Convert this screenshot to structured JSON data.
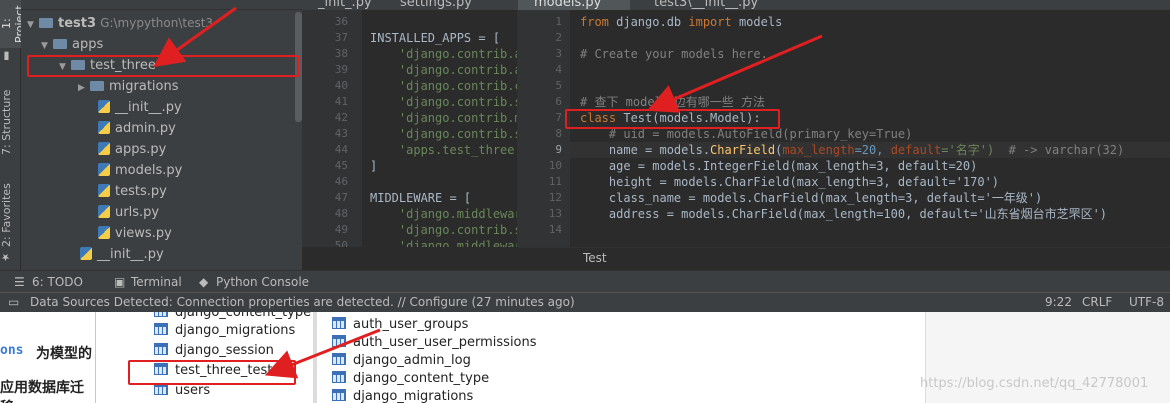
{
  "left_strip": {
    "project_tab": "1: Project",
    "structure_tab": "7: Structure",
    "favorites_tab": "2: Favorites"
  },
  "project_panel": {
    "header": "Project",
    "tree": [
      {
        "label": "test3",
        "suffix": "G:\\mypython\\test3",
        "type": "folder",
        "depth": 0,
        "expanded": true
      },
      {
        "label": "apps",
        "type": "folder",
        "depth": 1,
        "expanded": true
      },
      {
        "label": "test_three",
        "type": "folder",
        "depth": 2,
        "expanded": true
      },
      {
        "label": "migrations",
        "type": "folder",
        "depth": 3,
        "expanded": false
      },
      {
        "label": "__init__.py",
        "type": "py",
        "depth": 3
      },
      {
        "label": "admin.py",
        "type": "py",
        "depth": 3
      },
      {
        "label": "apps.py",
        "type": "py",
        "depth": 3
      },
      {
        "label": "models.py",
        "type": "py",
        "depth": 3
      },
      {
        "label": "tests.py",
        "type": "py",
        "depth": 3
      },
      {
        "label": "urls.py",
        "type": "py",
        "depth": 3
      },
      {
        "label": "views.py",
        "type": "py",
        "depth": 3
      },
      {
        "label": "__init__.py",
        "type": "py",
        "depth": 2
      }
    ]
  },
  "tabs": {
    "t1": "_init_.py",
    "t2": "settings.py",
    "t3": "models.py",
    "t4": "test3\\__init__.py"
  },
  "settings_editor": {
    "line_numbers": [
      "36",
      "37",
      "38",
      "39",
      "40",
      "41",
      "42",
      "43",
      "44",
      "45",
      "46",
      "47",
      "48",
      "49",
      "50"
    ],
    "lines": [
      "",
      "INSTALLED_APPS = [",
      "    'django.contrib.a",
      "    'django.contrib.a",
      "    'django.contrib.c",
      "    'django.contrib.s",
      "    'django.contrib.m",
      "    'django.contrib.s",
      "    'apps.test_three'",
      "]",
      "",
      "MIDDLEWARE = [",
      "    'django.middlewar",
      "    'django.contrib.s",
      "    'django.middlewar"
    ]
  },
  "models_editor": {
    "line_numbers": [
      "1",
      "2",
      "3",
      "4",
      "5",
      "6",
      "7",
      "8",
      "9",
      "10",
      "11",
      "12",
      "13",
      "14"
    ],
    "l1": "from django.db import models",
    "l3": "# Create your models here.",
    "l6": "# 查下 model中边有哪一些 方法",
    "l7": "class Test(models.Model):",
    "l8": "    # uid = models.AutoField(primary_key=True)",
    "l9a": "    name = models.",
    "l9b": "CharField",
    "l9c": "(",
    "l9d": "max_length",
    "l9e": "=20, ",
    "l9f": "default",
    "l9g": "='名字')",
    "l9h": "  # -> varchar(32)",
    "l10": "    age = models.IntegerField(max_length=3, default=20)",
    "l11": "    height = models.CharField(max_length=3, default='170')",
    "l12": "    class_name = models.CharField(max_length=3, default='一年级')",
    "l13": "    address = models.CharField(max_length=100, default='山东省烟台市芝罘区')"
  },
  "breadcrumb": "Test",
  "bottom_tools": {
    "todo": "6: TODO",
    "terminal": "Terminal",
    "python_console": "Python Console"
  },
  "status_bar": {
    "message": "Data Sources Detected: Connection properties are detected. // Configure (27 minutes ago)",
    "position": "9:22",
    "line_sep": "CRLF",
    "encoding": "UTF-8"
  },
  "lower_area": {
    "left_text_1": "ons",
    "left_text_1b": "为模型的",
    "left_text_2": "应用数据库迁移",
    "left_tables": [
      "django_content_type",
      "django_migrations",
      "django_session",
      "test_three_test",
      "users"
    ],
    "right_tables": [
      "auth_user_groups",
      "auth_user_user_permissions",
      "django_admin_log",
      "django_content_type",
      "django_migrations"
    ],
    "watermark": "https://blog.csdn.net/qq_42778001"
  },
  "colors": {
    "annotation_red": "#e02020",
    "editor_bg": "#2b2b2b",
    "panel_bg": "#3c3f41"
  }
}
